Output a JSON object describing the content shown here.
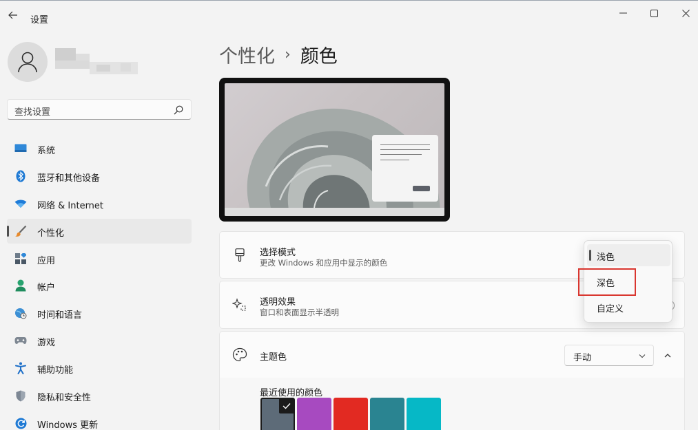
{
  "window": {
    "title": "设置",
    "back_icon": "arrow-left-icon",
    "controls": [
      "minimize-icon",
      "maximize-icon",
      "close-icon"
    ]
  },
  "user": {
    "avatar_icon": "person-icon"
  },
  "search": {
    "placeholder": "查找设置",
    "icon": "search-icon"
  },
  "sidebar": {
    "items": [
      {
        "label": "系统",
        "icon": "monitor-icon",
        "active": false
      },
      {
        "label": "蓝牙和其他设备",
        "icon": "bluetooth-icon",
        "active": false
      },
      {
        "label": "网络 & Internet",
        "icon": "wifi-icon",
        "active": false
      },
      {
        "label": "个性化",
        "icon": "brush-icon",
        "active": true
      },
      {
        "label": "应用",
        "icon": "apps-icon",
        "active": false
      },
      {
        "label": "帐户",
        "icon": "account-icon",
        "active": false
      },
      {
        "label": "时间和语言",
        "icon": "globe-clock-icon",
        "active": false
      },
      {
        "label": "游戏",
        "icon": "gamepad-icon",
        "active": false
      },
      {
        "label": "辅助功能",
        "icon": "accessibility-icon",
        "active": false
      },
      {
        "label": "隐私和安全性",
        "icon": "shield-icon",
        "active": false
      },
      {
        "label": "Windows 更新",
        "icon": "update-icon",
        "active": false
      }
    ]
  },
  "breadcrumb": {
    "parent": "个性化",
    "separator": "›",
    "current": "颜色"
  },
  "cards": {
    "mode": {
      "title": "选择模式",
      "subtitle": "更改 Windows 和应用中显示的颜色",
      "icon": "paintbrush-icon"
    },
    "transparency": {
      "title": "透明效果",
      "subtitle": "窗口和表面显示半透明",
      "icon": "sparkle-icon"
    },
    "accent": {
      "title": "主题色",
      "icon": "palette-icon",
      "select_value": "手动",
      "expand_icon": "chevron-up-icon"
    }
  },
  "recent_colors": {
    "label": "最近使用的颜色",
    "swatches": [
      {
        "color": "#5d6b78",
        "selected": true
      },
      {
        "color": "#a74ac0",
        "selected": false
      },
      {
        "color": "#e22a22",
        "selected": false
      },
      {
        "color": "#2a8491",
        "selected": false
      },
      {
        "color": "#06b8c6",
        "selected": false
      }
    ]
  },
  "mode_dropdown": {
    "options": [
      "浅色",
      "深色",
      "自定义"
    ],
    "selected": "浅色",
    "highlighted": "深色"
  },
  "colors": {
    "accent": "#4f4f4f",
    "highlight_box": "#d9362f"
  }
}
